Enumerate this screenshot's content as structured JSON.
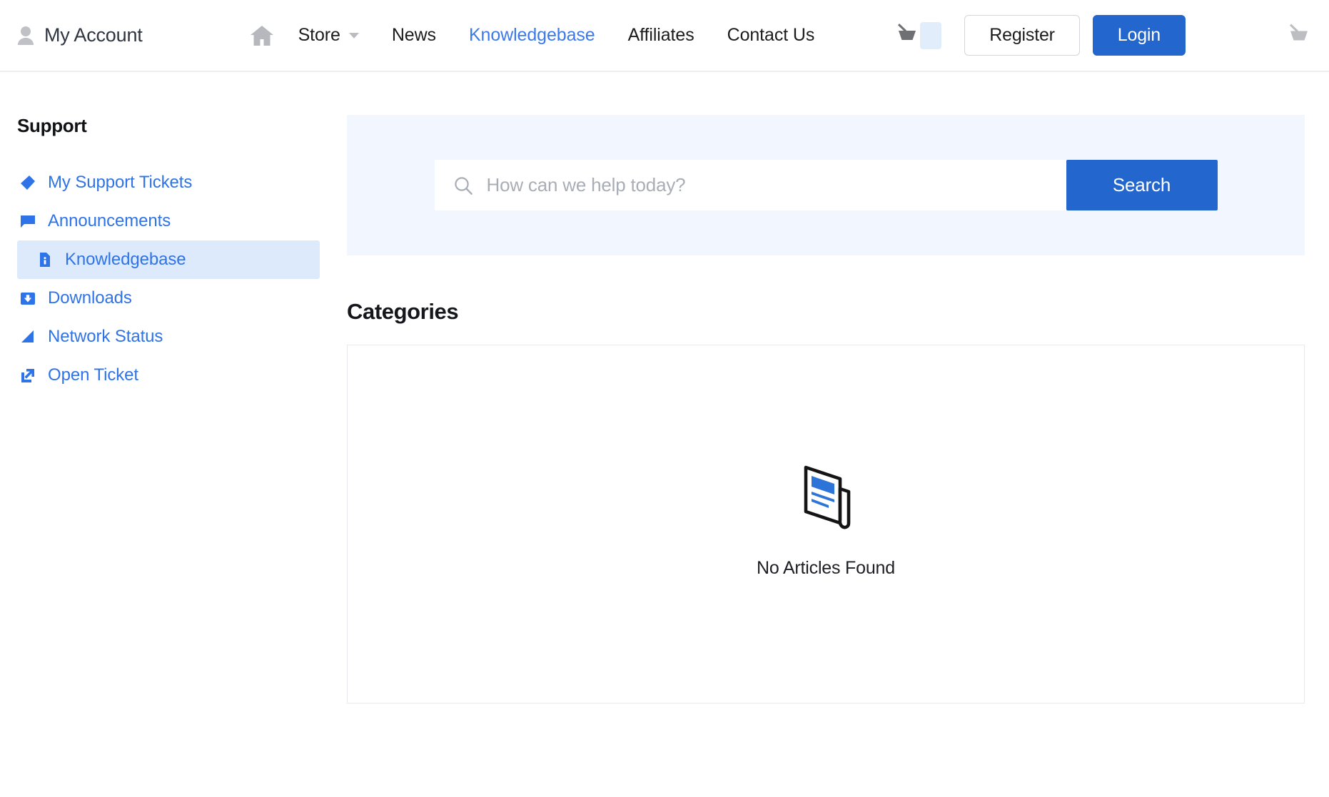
{
  "header": {
    "account": {
      "icon": "user-icon",
      "label": "My Account"
    },
    "home_icon": "home-icon",
    "nav": [
      {
        "label": "Store",
        "icon": "chevron-down-icon",
        "has_caret": true,
        "active": false
      },
      {
        "label": "News",
        "has_caret": false,
        "active": false
      },
      {
        "label": "Knowledgebase",
        "has_caret": false,
        "active": true
      },
      {
        "label": "Affiliates",
        "has_caret": false,
        "active": false
      },
      {
        "label": "Contact Us",
        "has_caret": false,
        "active": false
      }
    ],
    "cart": {
      "icon": "shopping-basket-icon",
      "badge_label": ""
    },
    "register_label": "Register",
    "login_label": "Login",
    "trailing_cart_icon": "shopping-basket-icon"
  },
  "sidebar": {
    "title": "Support",
    "items": [
      {
        "label": "My Support Tickets",
        "icon": "tag-icon",
        "active": false,
        "indented": false
      },
      {
        "label": "Announcements",
        "icon": "speech-bubble-icon",
        "active": false,
        "indented": false
      },
      {
        "label": "Knowledgebase",
        "icon": "file-info-icon",
        "active": true,
        "indented": true
      },
      {
        "label": "Downloads",
        "icon": "download-icon",
        "active": false,
        "indented": false
      },
      {
        "label": "Network Status",
        "icon": "signal-icon",
        "active": false,
        "indented": false
      },
      {
        "label": "Open Ticket",
        "icon": "external-link-icon",
        "active": false,
        "indented": false
      }
    ]
  },
  "search": {
    "icon": "search-icon",
    "placeholder": "How can we help today?",
    "value": "",
    "button_label": "Search"
  },
  "main": {
    "section_title": "Categories",
    "empty_state": {
      "icon": "article-document-icon",
      "message": "No Articles Found"
    }
  },
  "colors": {
    "accent_blue": "#2266ce",
    "link_blue": "#2e73e8",
    "nav_active_blue": "#3b79ec",
    "panel_bg": "#f2f6fe",
    "active_item_bg": "#ddeafb",
    "border_gray": "#e8e9ee",
    "text_dark": "#1c1c1e",
    "icon_gray": "#bfc1c6"
  }
}
